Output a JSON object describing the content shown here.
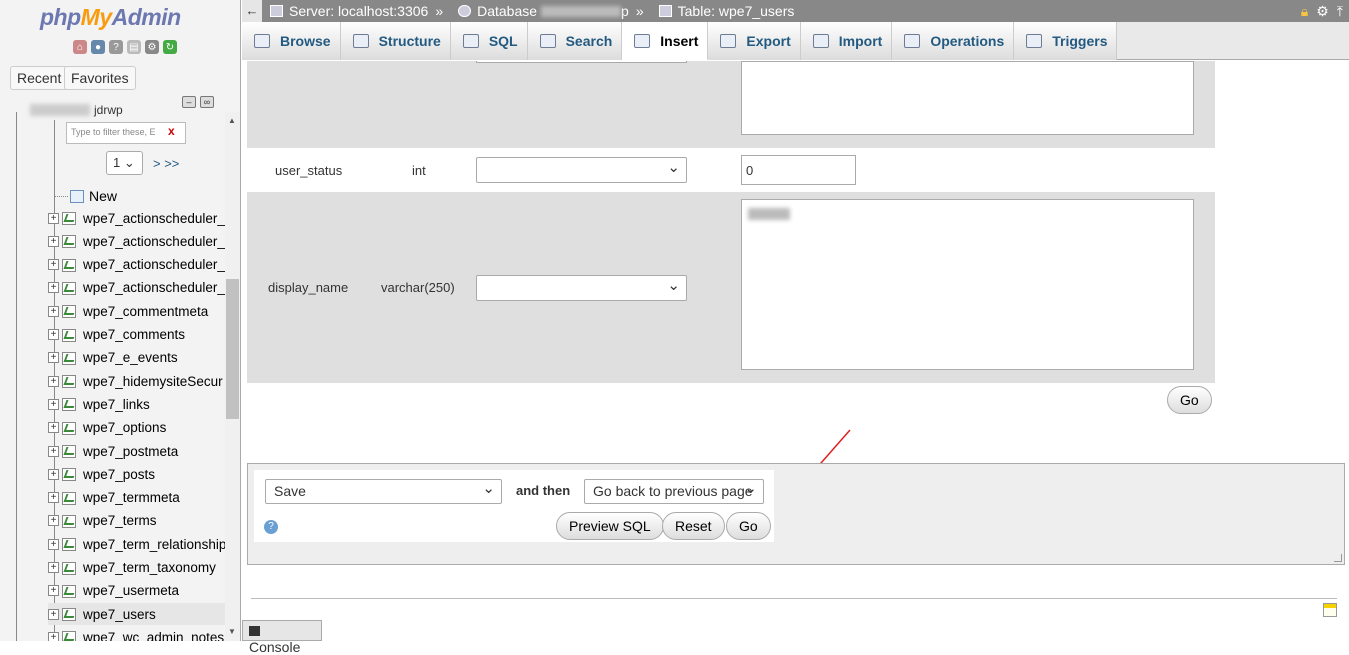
{
  "sidebar": {
    "logo": {
      "php": "php",
      "my": "My",
      "admin": "Admin"
    },
    "tabs": {
      "recent": "Recent",
      "favorites": "Favorites"
    },
    "db_name": "jdrwp",
    "filter_placeholder": "Type to filter these, E",
    "filter_clear": "x",
    "page_select": "1",
    "page_nav": "> >>",
    "new_label": "New",
    "tables": [
      "wpe7_actionscheduler_",
      "wpe7_actionscheduler_",
      "wpe7_actionscheduler_",
      "wpe7_actionscheduler_",
      "wpe7_commentmeta",
      "wpe7_comments",
      "wpe7_e_events",
      "wpe7_hidemysiteSecur",
      "wpe7_links",
      "wpe7_options",
      "wpe7_postmeta",
      "wpe7_posts",
      "wpe7_termmeta",
      "wpe7_terms",
      "wpe7_term_relationship",
      "wpe7_term_taxonomy",
      "wpe7_usermeta",
      "wpe7_users",
      "wpe7_wc_admin_notes"
    ],
    "selected_table": "wpe7_users"
  },
  "breadcrumb": {
    "back": "←",
    "server": "Server: localhost:3306",
    "database": "Database",
    "db_suffix": "p",
    "table": "Table: wpe7_users",
    "sep": "»"
  },
  "tabs": [
    {
      "label": "Browse",
      "icon": "browse-icon"
    },
    {
      "label": "Structure",
      "icon": "structure-icon"
    },
    {
      "label": "SQL",
      "icon": "sql-icon"
    },
    {
      "label": "Search",
      "icon": "search-icon"
    },
    {
      "label": "Insert",
      "icon": "insert-icon",
      "active": true
    },
    {
      "label": "Export",
      "icon": "export-icon"
    },
    {
      "label": "Import",
      "icon": "import-icon"
    },
    {
      "label": "Operations",
      "icon": "operations-icon"
    },
    {
      "label": "Triggers",
      "icon": "triggers-icon"
    }
  ],
  "fields": {
    "user_status": {
      "name": "user_status",
      "type": "int",
      "value": "0"
    },
    "display_name": {
      "name": "display_name",
      "type": "varchar(250)"
    }
  },
  "go_label": "Go",
  "action": {
    "save_select": "Save",
    "and_then": "and then",
    "then_select": "Go back to previous page",
    "preview_sql": "Preview SQL",
    "reset": "Reset",
    "go": "Go"
  },
  "console": "Console",
  "colors": {
    "accent": "#235a81",
    "annotation_arrow": "#e02020"
  }
}
